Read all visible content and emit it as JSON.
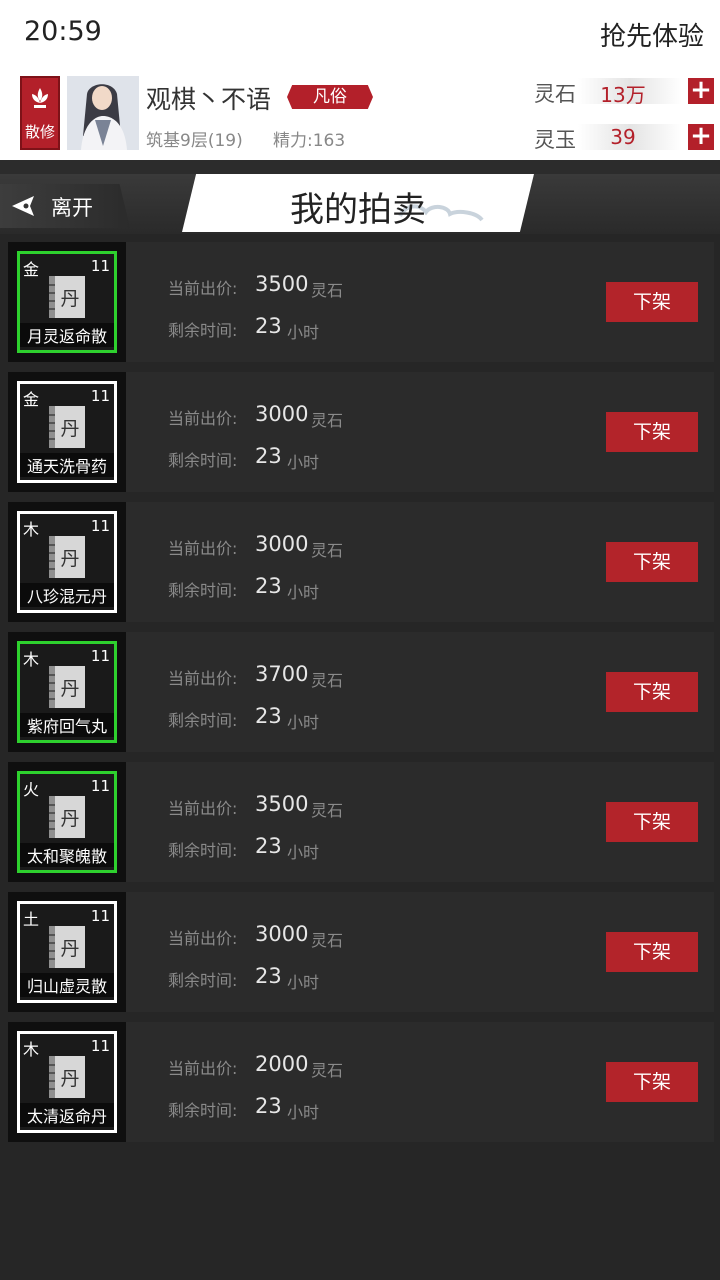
{
  "status_bar": {
    "time": "20:59",
    "early_access": "抢先体验"
  },
  "player": {
    "sect": "散修",
    "name": "观棋丶不语",
    "rank": "凡俗",
    "realm": "筑基9层(19)",
    "energy": "精力:163",
    "resources": [
      {
        "label": "灵石",
        "value": "13万"
      },
      {
        "label": "灵玉",
        "value": "39"
      }
    ],
    "plus_glyph": "+"
  },
  "header": {
    "leave_label": "离开",
    "title": "我的拍卖"
  },
  "labels": {
    "price_label": "当前出价:",
    "time_label": "剩余时间:",
    "price_unit": "灵石",
    "time_unit": "小时",
    "delist_button": "下架",
    "pill_char": "丹"
  },
  "auctions": [
    {
      "element": "金",
      "level": "11",
      "name": "月灵返命散",
      "price": "3500",
      "time": "23",
      "frame": "green"
    },
    {
      "element": "金",
      "level": "11",
      "name": "通天洗骨药",
      "price": "3000",
      "time": "23",
      "frame": "white"
    },
    {
      "element": "木",
      "level": "11",
      "name": "八珍混元丹",
      "price": "3000",
      "time": "23",
      "frame": "white"
    },
    {
      "element": "木",
      "level": "11",
      "name": "紫府回气丸",
      "price": "3700",
      "time": "23",
      "frame": "green"
    },
    {
      "element": "火",
      "level": "11",
      "name": "太和聚魄散",
      "price": "3500",
      "time": "23",
      "frame": "green"
    },
    {
      "element": "土",
      "level": "11",
      "name": "归山虚灵散",
      "price": "3000",
      "time": "23",
      "frame": "white"
    },
    {
      "element": "木",
      "level": "11",
      "name": "太清返命丹",
      "price": "2000",
      "time": "23",
      "frame": "white"
    }
  ],
  "colors": {
    "accent_red": "#b3202a",
    "rare_frame": "#2ed12e",
    "common_frame": "#ffffff"
  },
  "icons": {
    "sect_badge": "lotus-icon",
    "leave": "back-arrow-icon",
    "plus": "plus-icon"
  }
}
